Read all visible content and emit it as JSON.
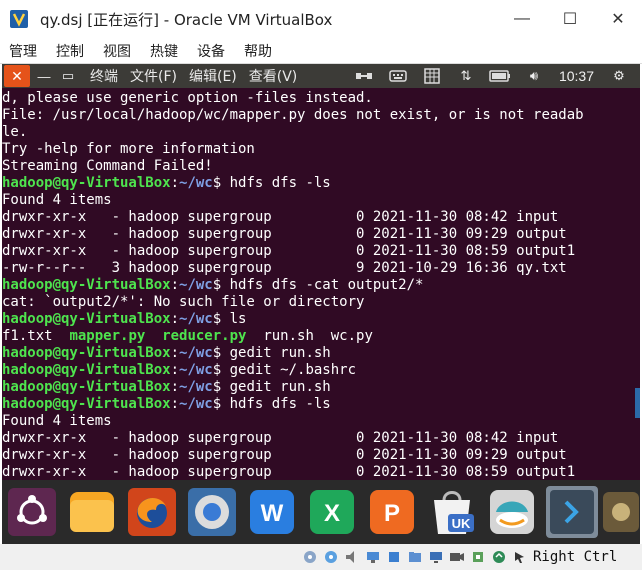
{
  "window": {
    "title": "qy.dsj [正在运行] - Oracle VM VirtualBox",
    "minimize": "—",
    "maximize": "☐",
    "close": "✕"
  },
  "vbox_menu": [
    "管理",
    "控制",
    "视图",
    "热键",
    "设备",
    "帮助"
  ],
  "topbar": {
    "menus": [
      "终端",
      "文件(F)",
      "编辑(E)",
      "查看(V)"
    ],
    "clock": "10:37"
  },
  "terminal": {
    "prompt_user": "hadoop@qy-VirtualBox",
    "lines": [
      {
        "t": "out",
        "text": "d, please use generic option -files instead."
      },
      {
        "t": "out",
        "text": "File: /usr/local/hadoop/wc/mapper.py does not exist, or is not readab"
      },
      {
        "t": "out",
        "text": "le."
      },
      {
        "t": "out",
        "text": "Try -help for more information"
      },
      {
        "t": "out",
        "text": "Streaming Command Failed!"
      },
      {
        "t": "cmd",
        "path": "~/wc",
        "cmd": "hdfs dfs -ls"
      },
      {
        "t": "out",
        "text": "Found 4 items"
      },
      {
        "t": "out",
        "text": "drwxr-xr-x   - hadoop supergroup          0 2021-11-30 08:42 input"
      },
      {
        "t": "out",
        "text": "drwxr-xr-x   - hadoop supergroup          0 2021-11-30 09:29 output"
      },
      {
        "t": "out",
        "text": "drwxr-xr-x   - hadoop supergroup          0 2021-11-30 08:59 output1"
      },
      {
        "t": "out",
        "text": "-rw-r--r--   3 hadoop supergroup          9 2021-10-29 16:36 qy.txt"
      },
      {
        "t": "cmd",
        "path": "~/wc",
        "cmd": "hdfs dfs -cat output2/*"
      },
      {
        "t": "out",
        "text": "cat: `output2/*': No such file or directory"
      },
      {
        "t": "cmd",
        "path": "~/wc",
        "cmd": "ls"
      },
      {
        "t": "ls",
        "items": [
          {
            "name": "f1.txt",
            "exec": false,
            "sep": "  "
          },
          {
            "name": "mapper.py",
            "exec": true,
            "sep": "  "
          },
          {
            "name": "reducer.py",
            "exec": true,
            "sep": "  "
          },
          {
            "name": "run.sh",
            "exec": false,
            "sep": "  "
          },
          {
            "name": "wc.py",
            "exec": false,
            "sep": ""
          }
        ]
      },
      {
        "t": "cmd",
        "path": "~/wc",
        "cmd": "gedit run.sh"
      },
      {
        "t": "cmd",
        "path": "~/wc",
        "cmd": "gedit ~/.bashrc"
      },
      {
        "t": "cmd",
        "path": "~/wc",
        "cmd": "gedit run.sh"
      },
      {
        "t": "cmd",
        "path": "~/wc",
        "cmd": "hdfs dfs -ls"
      },
      {
        "t": "out",
        "text": "Found 4 items"
      },
      {
        "t": "out",
        "text": "drwxr-xr-x   - hadoop supergroup          0 2021-11-30 08:42 input"
      },
      {
        "t": "out",
        "text": "drwxr-xr-x   - hadoop supergroup          0 2021-11-30 09:29 output"
      },
      {
        "t": "out",
        "text": "drwxr-xr-x   - hadoop supergroup          0 2021-11-30 08:59 output1"
      }
    ]
  },
  "dock": [
    {
      "name": "ubuntu-dash",
      "icon": "ubuntu-icon"
    },
    {
      "name": "files",
      "icon": "folder-icon"
    },
    {
      "name": "firefox",
      "icon": "firefox-icon"
    },
    {
      "name": "chromium",
      "icon": "browser-icon"
    },
    {
      "name": "wps-writer",
      "icon": "wps-writer-icon",
      "letter": "W"
    },
    {
      "name": "wps-spreadsheets",
      "icon": "wps-spreadsheet-icon",
      "letter": "X"
    },
    {
      "name": "wps-presentation",
      "icon": "wps-presentation-icon",
      "letter": "P"
    },
    {
      "name": "ubuntu-software",
      "icon": "software-center-icon",
      "letter": "UK"
    },
    {
      "name": "amazon",
      "icon": "amazon-icon"
    },
    {
      "name": "terminal",
      "icon": "terminal-icon"
    }
  ],
  "statusbar": {
    "host_key": "Right Ctrl"
  },
  "colors": {
    "terminal_bg": "#300a24",
    "prompt_green": "#4ee44e",
    "path_blue": "#7e9fe3",
    "topbar_bg": "#3c3b37",
    "close_orange": "#e5531a"
  }
}
